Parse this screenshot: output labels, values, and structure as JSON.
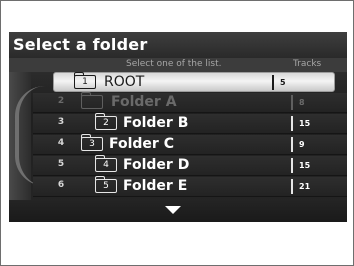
{
  "screen": {
    "title": "Select a folder",
    "instruction": "Select one of the list.",
    "tracks_header": "Tracks"
  },
  "folders": [
    {
      "num": "1",
      "icon_num": "1",
      "name": "ROOT",
      "tracks": "5"
    },
    {
      "num": "2",
      "icon_num": "",
      "name": "Folder A",
      "tracks": "8"
    },
    {
      "num": "3",
      "icon_num": "2",
      "name": "Folder B",
      "tracks": "15"
    },
    {
      "num": "4",
      "icon_num": "3",
      "name": "Folder C",
      "tracks": "9"
    },
    {
      "num": "5",
      "icon_num": "4",
      "name": "Folder D",
      "tracks": "15"
    },
    {
      "num": "6",
      "icon_num": "5",
      "name": "Folder E",
      "tracks": "21"
    }
  ],
  "icons": {
    "folder": "folder-icon",
    "scroll_down": "scroll-down-arrow-icon"
  },
  "colors": {
    "screen_background": "#262626",
    "selected_row": "#e8e8e8",
    "text": "#ffffff"
  }
}
